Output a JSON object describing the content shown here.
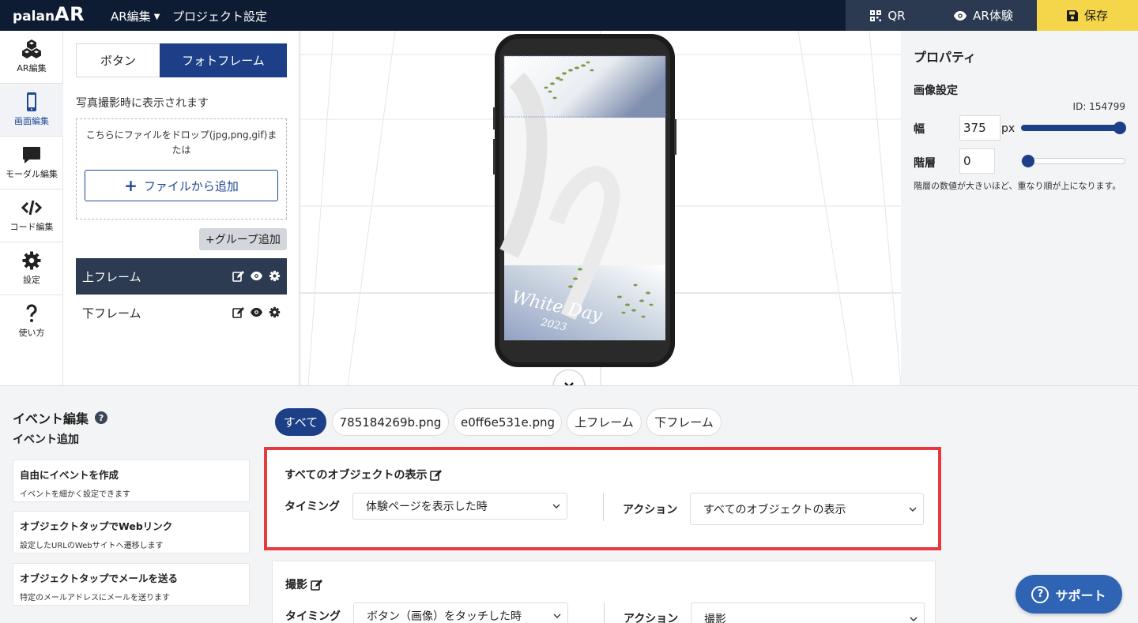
{
  "header": {
    "logo_small": "palan",
    "logo_big": "AR",
    "menu_ar_edit": "AR編集",
    "menu_project_settings": "プロジェクト設定",
    "qr_label": "QR",
    "ar_experience_label": "AR体験",
    "save_label": "保存",
    "colors": {
      "bar": "#0e1c33",
      "save": "#f5d54a"
    }
  },
  "nav": {
    "items": [
      {
        "label": "AR編集",
        "icon": "cubes-icon"
      },
      {
        "label": "画面編集",
        "icon": "smartphone-icon"
      },
      {
        "label": "モーダル編集",
        "icon": "chat-bubble-icon"
      },
      {
        "label": "コード編集",
        "icon": "code-icon"
      },
      {
        "label": "設定",
        "icon": "gear-icon"
      },
      {
        "label": "使い方",
        "icon": "question-icon"
      }
    ],
    "active": "画面編集"
  },
  "left_panel": {
    "tabs": [
      "ボタン",
      "フォトフレーム"
    ],
    "active_tab": "フォトフレーム",
    "hint": "写真撮影時に表示されます",
    "drop_text": "こちらにファイルをドロップ(jpg,png,gif)または",
    "add_file_label": "ファイルから追加",
    "add_group_label": "+グループ追加",
    "frames": [
      {
        "name": "上フレーム",
        "selected": true
      },
      {
        "name": "下フレーム",
        "selected": false
      }
    ]
  },
  "canvas": {
    "frame_text": "White Day",
    "frame_year": "2023"
  },
  "properties": {
    "title": "プロパティ",
    "section": "画像設定",
    "id_text": "ID: 154799",
    "width_label": "幅",
    "width_value": "375",
    "width_unit": "px",
    "width_slider_level": 1.0,
    "layer_label": "階層",
    "layer_value": "0",
    "layer_slider_level": 0.0,
    "layer_note": "階層の数値が大きいほど、重なり順が上になります。"
  },
  "events": {
    "title": "イベント編集",
    "help_icon": "question-circle-icon",
    "add_title": "イベント追加",
    "templates": [
      {
        "title": "自由にイベントを作成",
        "desc": "イベントを細かく設定できます"
      },
      {
        "title": "オブジェクトタップでWebリンク",
        "desc": "設定したURLのWebサイトへ遷移します"
      },
      {
        "title": "オブジェクトタップでメールを送る",
        "desc": "特定のメールアドレスにメールを送ります"
      }
    ],
    "filters": [
      "すべて",
      "785184269b.png",
      "e0ff6e531e.png",
      "上フレーム",
      "下フレーム"
    ],
    "active_filter": "すべて",
    "list": [
      {
        "title": "すべてのオブジェクトの表示",
        "timing_label": "タイミング",
        "timing_value": "体験ページを表示した時",
        "action_label": "アクション",
        "action_value": "すべてのオブジェクトの表示",
        "highlighted": true
      },
      {
        "title": "撮影",
        "timing_label": "タイミング",
        "timing_value": "ボタン（画像）をタッチした時",
        "action_label": "アクション",
        "action_value": "撮影",
        "highlighted": false
      }
    ]
  },
  "support_label": "サポート"
}
